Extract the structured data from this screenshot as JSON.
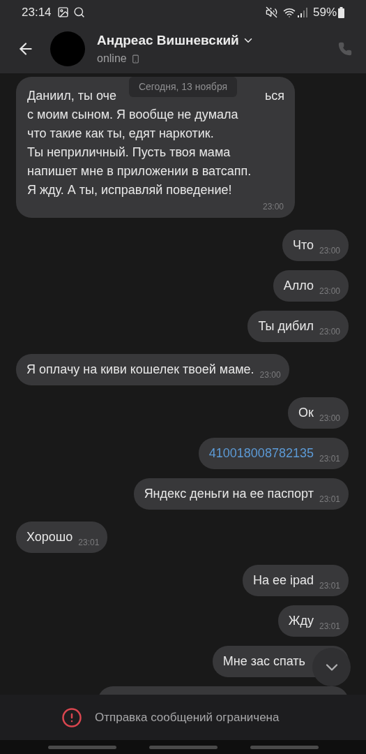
{
  "status_bar": {
    "time": "23:14",
    "battery": "59%"
  },
  "header": {
    "name": "Андреас Вишневский",
    "status": "online"
  },
  "date_badge": "Сегодня, 13 ноября",
  "messages": [
    {
      "outgoing": false,
      "kind": "covered",
      "covered_line": {
        "before": "Даниил, ты оче",
        "after": "ься"
      },
      "lines": [
        "с моим сыном. Я вообще не думала",
        "что такие как ты, едят наркотик.",
        "Ты неприличный. Пусть твоя мама",
        "напишет мне в приложении в ватсапп.",
        "Я жду. А ты, исправляй поведение!"
      ],
      "time": "23:00"
    },
    {
      "outgoing": true,
      "kind": "text",
      "text": "Что",
      "time": "23:00"
    },
    {
      "outgoing": true,
      "kind": "text",
      "text": "Алло",
      "time": "23:00"
    },
    {
      "outgoing": true,
      "kind": "text",
      "text": "Ты дибил",
      "time": "23:00"
    },
    {
      "outgoing": false,
      "kind": "text",
      "text": "Я оплачу на киви кошелек твоей маме.",
      "time": "23:00"
    },
    {
      "outgoing": true,
      "kind": "text",
      "text": "Ок",
      "time": "23:00"
    },
    {
      "outgoing": true,
      "kind": "link",
      "text": "410018008782135",
      "time": "23:01"
    },
    {
      "outgoing": true,
      "kind": "text",
      "text": "Яндекс деньги на ее паспорт",
      "time": "23:01"
    },
    {
      "outgoing": false,
      "kind": "text",
      "text": "Хорошо",
      "time": "23:01"
    },
    {
      "outgoing": true,
      "kind": "text",
      "text": "На ее ipad",
      "time": "23:01"
    },
    {
      "outgoing": true,
      "kind": "text",
      "text": "Жду",
      "time": "23:01"
    },
    {
      "outgoing": true,
      "kind": "text",
      "text": "Мне зас спать"
    },
    {
      "outgoing": true,
      "kind": "partial"
    }
  ],
  "notice": "Отправка сообщений ограничена"
}
